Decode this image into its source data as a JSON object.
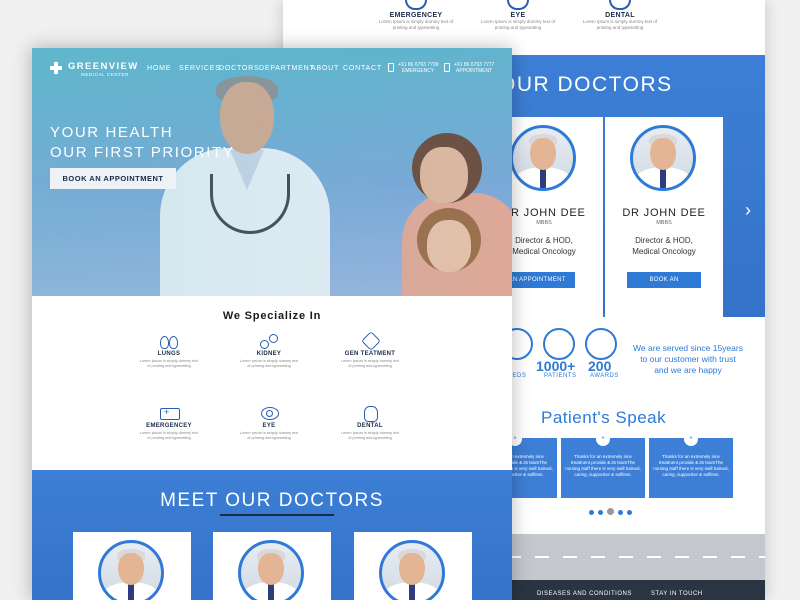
{
  "back": {
    "specialties": [
      {
        "label": "EMERGENCEY",
        "sub": "Lorem Ipsum is simply dummy text of printing and typesetting"
      },
      {
        "label": "EYE",
        "sub": "Lorem Ipsum is simply dummy text of printing and typesetting"
      },
      {
        "label": "DENTAL",
        "sub": "Lorem Ipsum is simply dummy text of printing and typesetting"
      }
    ],
    "doctors_title": "OUR DOCTORS",
    "doctors": [
      {
        "name": "DR JOHN DEE",
        "degree": "MBBS",
        "role_line1": "Director & HOD,",
        "role_line2": "Medical Oncology",
        "button": "BOOK AN APPOINTMENT"
      },
      {
        "name": "DR JOHN DEE",
        "degree": "MBBS",
        "role_line1": "Director & HOD,",
        "role_line2": "Medical Oncology",
        "button": "BOOK AN APPOINTMENT"
      }
    ],
    "next_arrow": "›",
    "stats": [
      {
        "number": "00",
        "label": "BEDS"
      },
      {
        "number": "1000+",
        "label": "PATIENTS"
      },
      {
        "number": "200",
        "label": "AWARDS"
      }
    ],
    "stats_text_line1": "We are served since 15years",
    "stats_text_line2": "to our customer with trust",
    "stats_text_line3": "and we are happy",
    "speak_title": "Patient's Speak",
    "quotes": [
      {
        "text": "Thanks for an extremely nice treatment provide & its teamThe nursing staff there is very well trained, caring, supportive & selfless."
      },
      {
        "text": "Thanks for an extremely nice treatment provide & its teamThe nursing staff there is very well trained, caring, supportive & selfless."
      },
      {
        "text": "Thanks for an extremely nice treatment provide & its teamThe nursing staff there is very well trained, caring, supportive & selfless."
      }
    ],
    "footer": {
      "col1": "DISEASES AND CONDITIONS",
      "col2": "STAY IN TOUCH"
    }
  },
  "front": {
    "logo": {
      "name": "GREENVIEW",
      "sub": "MEDICAL CENTER"
    },
    "nav": [
      "HOME",
      "SERVICES",
      "DOCTORS",
      "DEPARTMENT",
      "ABOUT",
      "CONTACT"
    ],
    "contact_emergency": {
      "phone": "+91 86 6793 7799",
      "label": "EMERGENCY"
    },
    "contact_appointment": {
      "phone": "+91 86 6793 7777",
      "label": "APPOINTMENT"
    },
    "hero": {
      "line1": "YOUR HEALTH",
      "line2": "OUR FIRST PRIORITY",
      "button": "BOOK AN APPOINTMENT"
    },
    "spec_title": "We Specialize In",
    "specialties": [
      {
        "label": "LUNGS",
        "sub1": "Lorem Ipsum is simply dummy text",
        "sub2": "of printing and typesetting"
      },
      {
        "label": "KIDNEY",
        "sub1": "Lorem Ipsum is simply dummy text",
        "sub2": "of printing and typesetting"
      },
      {
        "label": "GEN TEATMENT",
        "sub1": "Lorem Ipsum is simply dummy text",
        "sub2": "of printing and typesetting"
      },
      {
        "label": "EMERGENCEY",
        "sub1": "Lorem Ipsum is simply dummy text",
        "sub2": "of printing and typesetting"
      },
      {
        "label": "EYE",
        "sub1": "Lorem Ipsum is simply dummy text",
        "sub2": "of printing and typesetting"
      },
      {
        "label": "DENTAL",
        "sub1": "Lorem Ipsum is simply dummy text",
        "sub2": "of printing and typesetting"
      }
    ],
    "meet_title": "MEET OUR DOCTORS"
  },
  "colors": {
    "primary_blue": "#3d7fd6",
    "hero_teal": "#5fb6cc",
    "navy_text": "#1a2b4a"
  }
}
